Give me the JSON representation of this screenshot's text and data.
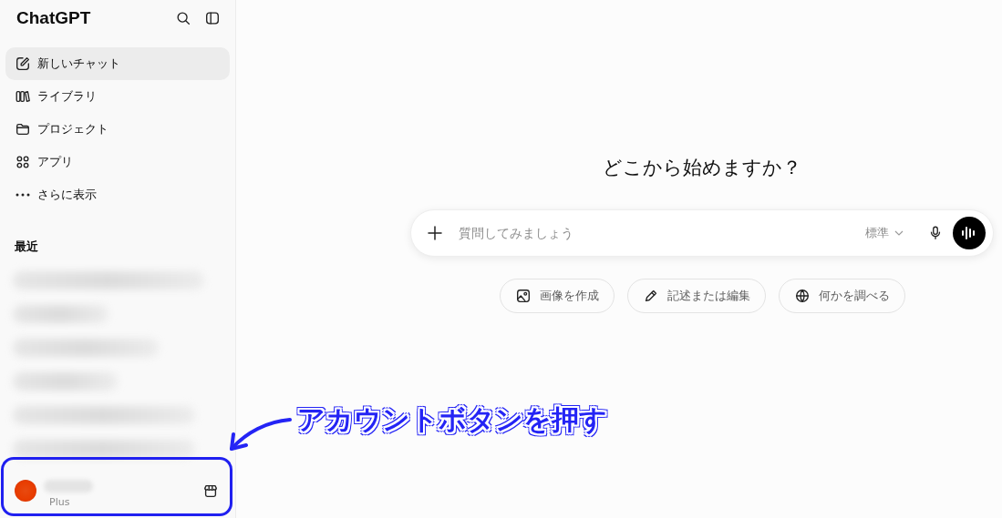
{
  "sidebar": {
    "title": "ChatGPT",
    "nav": [
      {
        "label": "新しいチャット",
        "kind": "edit",
        "selected": true
      },
      {
        "label": "ライブラリ",
        "kind": "library",
        "selected": false
      },
      {
        "label": "プロジェクト",
        "kind": "folder",
        "selected": false
      },
      {
        "label": "アプリ",
        "kind": "apps",
        "selected": false
      },
      {
        "label": "さらに表示",
        "kind": "more",
        "selected": false
      }
    ],
    "section_title": "最近",
    "recent": [
      {
        "kind": "blurred"
      },
      {
        "kind": "blurred"
      },
      {
        "kind": "blurred"
      },
      {
        "kind": "blurred"
      },
      {
        "kind": "blurred"
      },
      {
        "kind": "blurred"
      }
    ],
    "account": {
      "plan": "Plus"
    }
  },
  "main": {
    "heading": "どこから始めますか？",
    "composer": {
      "placeholder": "質問してみましょう",
      "model": "標準"
    },
    "chips": [
      {
        "label": "画像を作成",
        "kind": "image"
      },
      {
        "label": "記述または編集",
        "kind": "pencil"
      },
      {
        "label": "何かを調べる",
        "kind": "globe"
      }
    ]
  },
  "annotation": {
    "text": "アカウントボタンを押す"
  }
}
